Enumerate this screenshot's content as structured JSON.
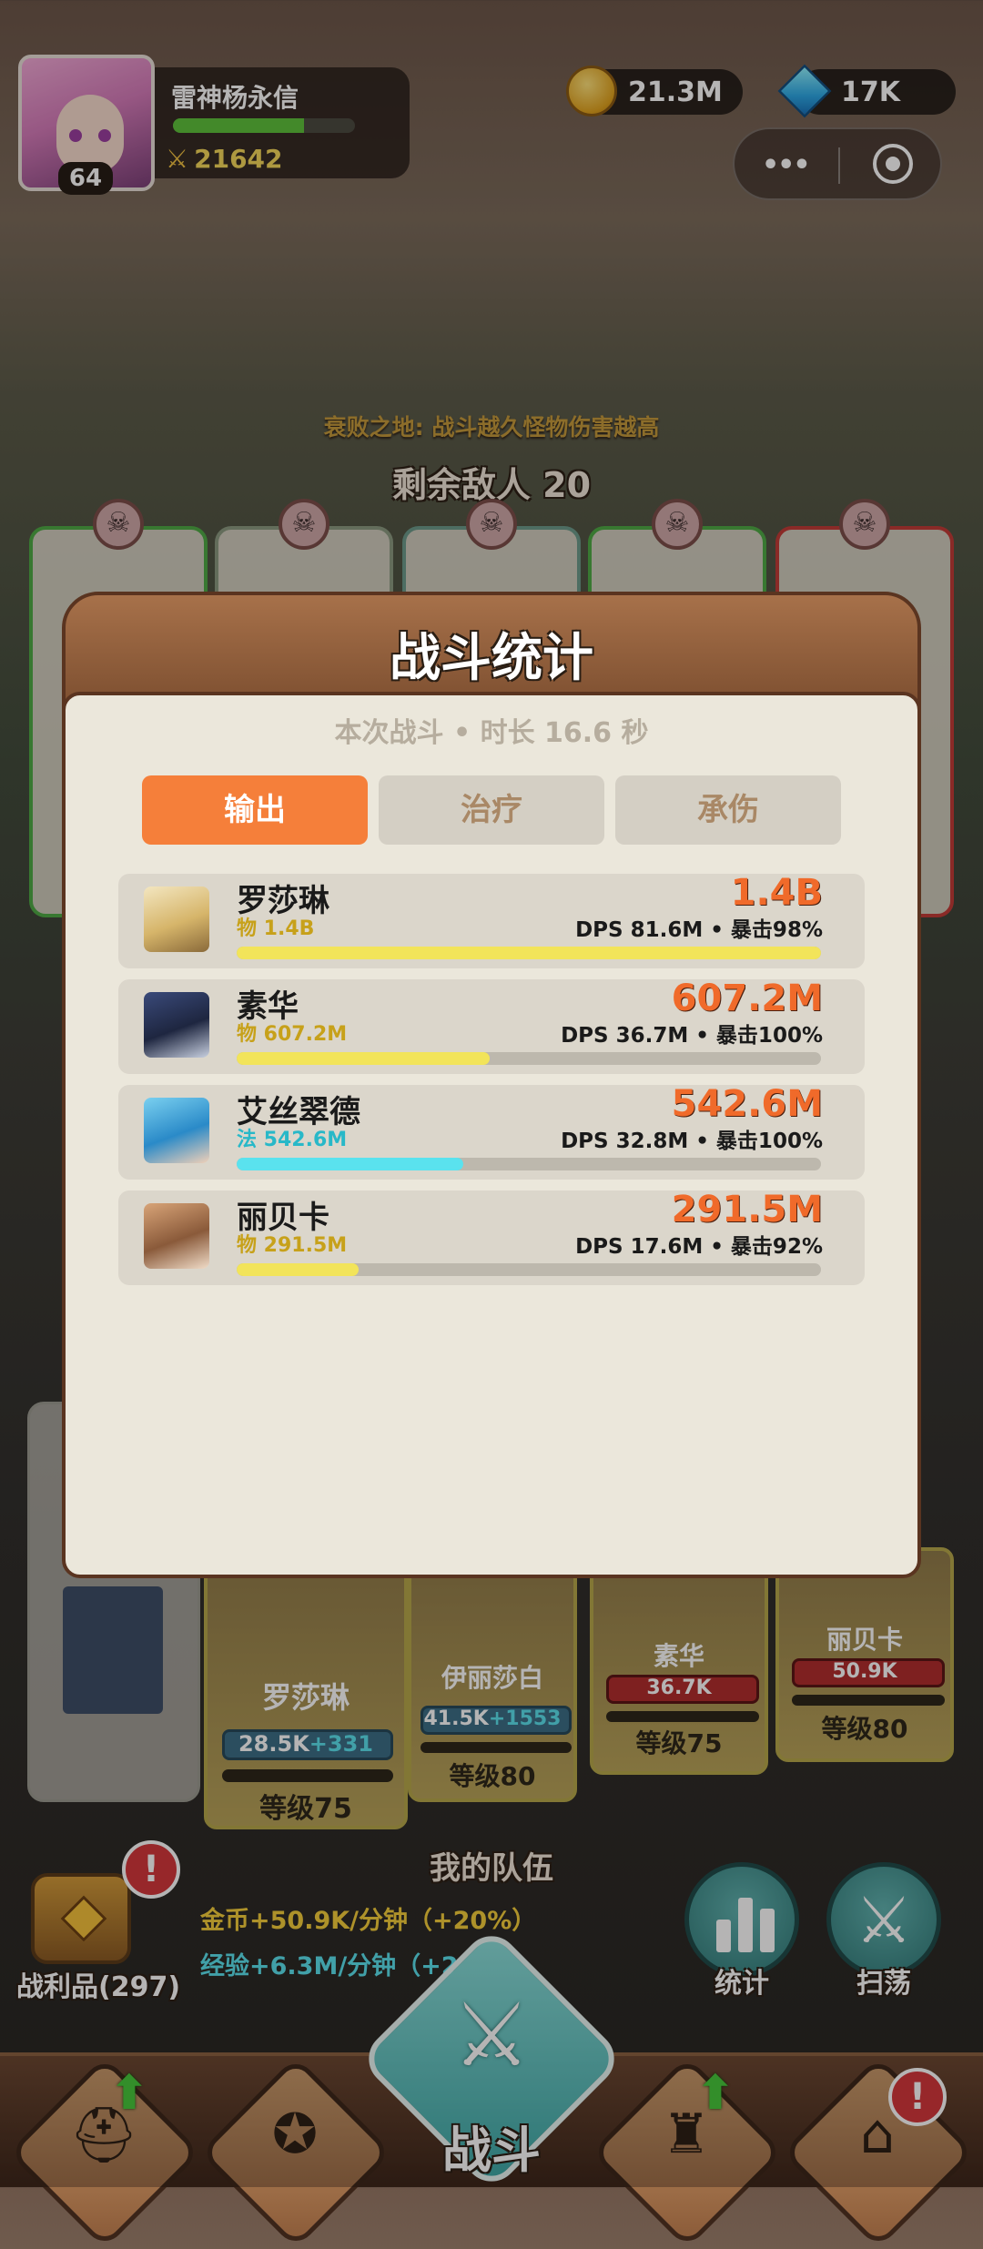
{
  "player": {
    "name": "雷神杨永信",
    "level": "64",
    "power": "21642",
    "xp_fraction": 0.72
  },
  "currency": {
    "gold": "21.3M",
    "gems": "17K"
  },
  "menu": {
    "more": "•••"
  },
  "stage": {
    "modifier": "衰败之地: 战斗越久怪物伤害越高",
    "enemies_left": "剩余敌人 20"
  },
  "stats_modal": {
    "title": "战斗统计",
    "subtitle": "本次战斗 • 时长 16.6 秒",
    "tabs": [
      "输出",
      "治疗",
      "承伤"
    ],
    "active_tab": "输出",
    "rows": [
      {
        "name": "罗莎琳",
        "detail": "物 1.4B",
        "value": "1.4B",
        "stat": "DPS 81.6M • 暴击98%",
        "fraction": 1.0,
        "bar_color": "#f2e45a",
        "detail_color": "#c7a11a"
      },
      {
        "name": "素华",
        "detail": "物 607.2M",
        "value": "607.2M",
        "stat": "DPS 36.7M • 暴击100%",
        "fraction": 0.4337,
        "bar_color": "#f2e45a",
        "detail_color": "#c7a11a"
      },
      {
        "name": "艾丝翠德",
        "detail": "法 542.6M",
        "value": "542.6M",
        "stat": "DPS 32.8M • 暴击100%",
        "fraction": 0.3876,
        "bar_color": "#5ae2ee",
        "detail_color": "#28b8c8"
      },
      {
        "name": "丽贝卡",
        "detail": "物 291.5M",
        "value": "291.5M",
        "stat": "DPS 17.6M • 暴击92%",
        "fraction": 0.2082,
        "bar_color": "#f2e45a",
        "detail_color": "#c7a11a"
      }
    ]
  },
  "team": {
    "title": "我的队伍",
    "members": [
      {
        "name": "罗莎琳",
        "hp": "28.5K",
        "bonus": "+331",
        "level": "等级75"
      },
      {
        "name": "伊丽莎白",
        "hp": "41.5K",
        "bonus": "+1553",
        "level": "等级80"
      },
      {
        "name": "素华",
        "hp": "36.7K",
        "bonus": "",
        "level": "等级75"
      },
      {
        "name": "丽贝卡",
        "hp": "50.9K",
        "bonus": "",
        "level": "等级80"
      }
    ]
  },
  "rewards": {
    "loot_label": "战利品(297)",
    "gold_rate": "金币+50.9K/分钟（+20%）",
    "exp_rate": "经验+6.3M/分钟（+2"
  },
  "actions": {
    "stats_label": "统计",
    "sweep_label": "扫荡"
  },
  "nav": {
    "center_label": "战斗",
    "alert_mark": "!"
  },
  "colors": {
    "accent_orange": "#f57f3a",
    "value_orange": "#f06a2a",
    "physical_yellow": "#f2e45a",
    "magic_cyan": "#5ae2ee"
  },
  "icons": {
    "power": "sword-icon",
    "enemy": "skull-icon",
    "stats": "bar-chart-icon",
    "sweep": "sword-icon",
    "battle": "crossed-swords-icon"
  }
}
